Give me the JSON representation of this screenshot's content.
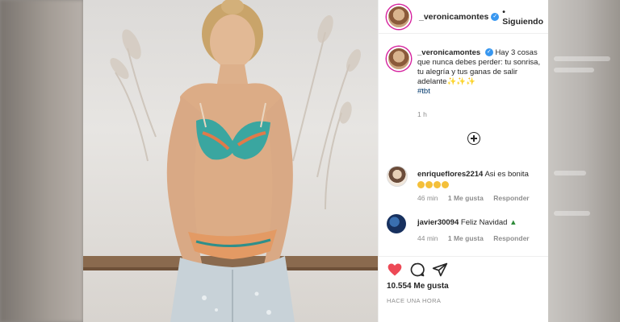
{
  "post": {
    "username": "_veronicamontes",
    "follow_status": "Siguiendo",
    "caption": "Hay 3 cosas que nunca debes perder: tu sonrisa, tu alegría y tus ganas de salir adelante✨✨✨",
    "hashtag": "#tbt",
    "time": "1 h"
  },
  "comments": [
    {
      "username": "enriqueflores2214",
      "text": "Asi es bonita",
      "emoji_count": 4,
      "time": "46 min",
      "likes": "1 Me gusta",
      "reply": "Responder"
    },
    {
      "username": "javier30094",
      "text": "Feliz Navidad",
      "trailing_emoji": "tree",
      "time": "44 min",
      "likes": "1 Me gusta",
      "reply": "Responder"
    }
  ],
  "engagement": {
    "likes": "10.554 Me gusta",
    "posted": "HACE UNA HORA"
  },
  "icons": [
    "heart-icon",
    "comment-icon",
    "share-icon",
    "add-comment-icon",
    "verified-icon"
  ],
  "colors": {
    "heart": "#ed4956",
    "verified": "#3897f0",
    "link": "#00376b"
  }
}
